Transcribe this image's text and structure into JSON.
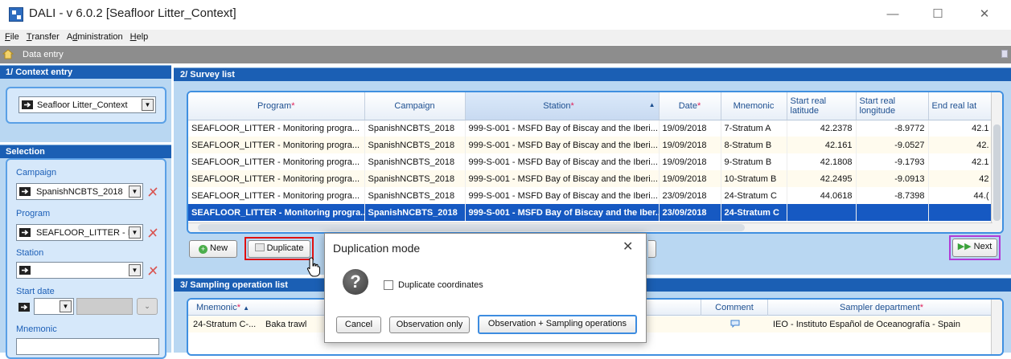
{
  "window": {
    "title": "DALI - v 6.0.2 [Seafloor Litter_Context]",
    "minimize": "—",
    "maximize": "☐",
    "close": "✕"
  },
  "menu": [
    "File",
    "Transfer",
    "Administration",
    "Help"
  ],
  "menu_mnemonics": [
    "F",
    "T",
    "d",
    "H"
  ],
  "screen_title": "Data entry",
  "context": {
    "header": "1/ Context entry",
    "value": "Seafloor Litter_Context"
  },
  "selection": {
    "header": "Selection",
    "campaign_label": "Campaign",
    "campaign_value": "SpanishNCBTS_2018",
    "program_label": "Program",
    "program_value": "SEAFLOOR_LITTER - I",
    "station_label": "Station",
    "station_value": "",
    "start_date_label": "Start date",
    "mnemonic_label": "Mnemonic"
  },
  "survey": {
    "header": "2/ Survey list",
    "columns": [
      "Program",
      "Campaign",
      "Station",
      "Date",
      "Mnemonic",
      "Start real latitude",
      "Start real longitude",
      "End real lat"
    ],
    "required_mark": "*",
    "sort_arrow": "▲",
    "rows": [
      [
        "SEAFLOOR_LITTER - Monitoring progra...",
        "SpanishNCBTS_2018",
        "999-S-001 - MSFD Bay of Biscay and the Iberi...",
        "19/09/2018",
        "7-Stratum A",
        "42.2378",
        "-8.9772",
        "42.1"
      ],
      [
        "SEAFLOOR_LITTER - Monitoring progra...",
        "SpanishNCBTS_2018",
        "999-S-001 - MSFD Bay of Biscay and the Iberi...",
        "19/09/2018",
        "8-Stratum B",
        "42.161",
        "-9.0527",
        "42."
      ],
      [
        "SEAFLOOR_LITTER - Monitoring progra...",
        "SpanishNCBTS_2018",
        "999-S-001 - MSFD Bay of Biscay and the Iberi...",
        "19/09/2018",
        "9-Stratum B",
        "42.1808",
        "-9.1793",
        "42.1"
      ],
      [
        "SEAFLOOR_LITTER - Monitoring progra...",
        "SpanishNCBTS_2018",
        "999-S-001 - MSFD Bay of Biscay and the Iberi...",
        "19/09/2018",
        "10-Stratum B",
        "42.2495",
        "-9.0913",
        "42"
      ],
      [
        "SEAFLOOR_LITTER - Monitoring progra...",
        "SpanishNCBTS_2018",
        "999-S-001 - MSFD Bay of Biscay and the Iberi...",
        "23/09/2018",
        "24-Stratum C",
        "44.0618",
        "-8.7398",
        "44.("
      ],
      [
        "SEAFLOOR_LITTER - Monitoring progra...",
        "SpanishNCBTS_2018",
        "999-S-001 - MSFD Bay of Biscay and the Iber...",
        "23/09/2018",
        "24-Stratum C",
        "",
        "",
        ""
      ]
    ],
    "buttons": {
      "new": "New",
      "duplicate": "Duplicate",
      "next": "Next"
    }
  },
  "sampling": {
    "header": "3/ Sampling operation list",
    "columns": [
      "Mnemonic",
      "Comment",
      "Sampler department"
    ],
    "row": {
      "mnemonic": "24-Stratum C-...",
      "gear": "Baka trawl",
      "department": "IEO - Instituto Español de Oceanografía - Spain"
    }
  },
  "dialog": {
    "title": "Duplication mode",
    "checkbox_label": "Duplicate coordinates",
    "cancel": "Cancel",
    "obs_only": "Observation only",
    "obs_sampling": "Observation + Sampling operations",
    "question_mark": "?",
    "close": "✕"
  }
}
